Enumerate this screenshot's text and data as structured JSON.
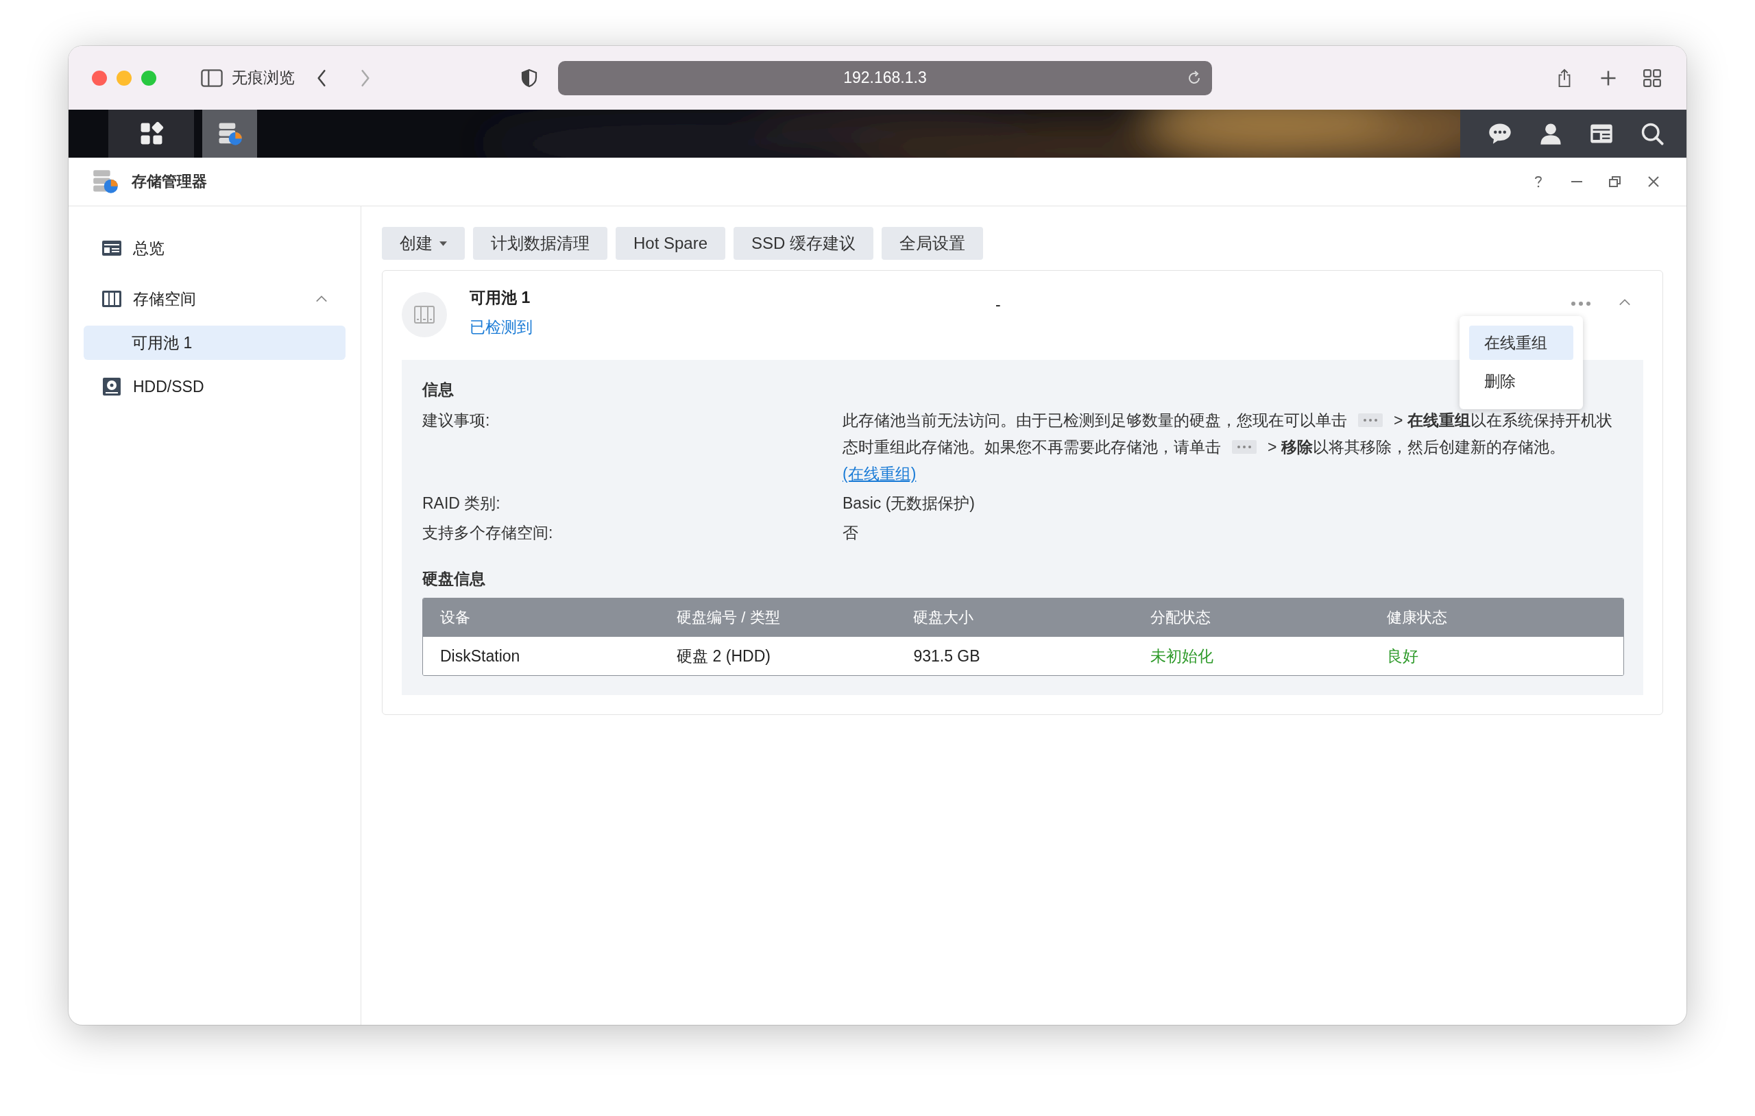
{
  "browser": {
    "private_label": "无痕浏览",
    "address": "192.168.1.3"
  },
  "taskbar": {
    "apps": [
      {
        "kind": "main-menu",
        "selected": false
      },
      {
        "kind": "storage",
        "selected": true
      }
    ]
  },
  "app": {
    "title": "存储管理器"
  },
  "sidebar": {
    "items": [
      {
        "kind": "overview",
        "label": "总览",
        "selected": false
      },
      {
        "kind": "storage",
        "label": "存储空间",
        "selected": false,
        "expanded": true,
        "children": [
          {
            "label": "可用池 1",
            "selected": true
          }
        ]
      },
      {
        "kind": "disk",
        "label": "HDD/SSD",
        "selected": false
      }
    ]
  },
  "toolbar": {
    "buttons": [
      {
        "label": "创建",
        "dropdown": true
      },
      {
        "label": "计划数据清理",
        "dropdown": false
      },
      {
        "label": "Hot Spare",
        "dropdown": false
      },
      {
        "label": "SSD 缓存建议",
        "dropdown": false
      },
      {
        "label": "全局设置",
        "dropdown": false
      }
    ]
  },
  "pool": {
    "name": "可用池 1",
    "status": "已检测到",
    "column_2": "-",
    "expanded": true,
    "menu": {
      "items": [
        {
          "label": "在线重组",
          "selected": true
        },
        {
          "label": "删除",
          "selected": false
        }
      ]
    },
    "info": {
      "heading": "信息",
      "rows": [
        {
          "label": "建议事项:",
          "segments": [
            {
              "kind": "text",
              "text": "此存储池当前无法访问。由于已检测到足够数量的硬盘，您现在可以单击"
            },
            {
              "kind": "menu-chip"
            },
            {
              "kind": "text",
              "text": "> **在线重组**以在系统保持开机状态时重组此存储池。如果您不再需要此存储池，请单击"
            },
            {
              "kind": "menu-chip"
            },
            {
              "kind": "text",
              "text": "> **移除**以将其移除，然后创建新的存储池。"
            },
            {
              "kind": "link",
              "text": "(在线重组)"
            }
          ]
        },
        {
          "label": "RAID 类别:",
          "value": "Basic (无数据保护)"
        },
        {
          "label": "支持多个存储空间:",
          "value": "否"
        }
      ]
    },
    "disks": {
      "heading": "硬盘信息",
      "columns": [
        "设备",
        "硬盘编号 / 类型",
        "硬盘大小",
        "分配状态",
        "健康状态"
      ],
      "rows": [
        {
          "cells": [
            {
              "text": "DiskStation"
            },
            {
              "text": "硬盘 2 (HDD)"
            },
            {
              "text": "931.5 GB"
            },
            {
              "text": "未初始化",
              "color": "#2e9a2a"
            },
            {
              "text": "良好",
              "color": "#2e9a2a"
            }
          ]
        }
      ]
    }
  }
}
